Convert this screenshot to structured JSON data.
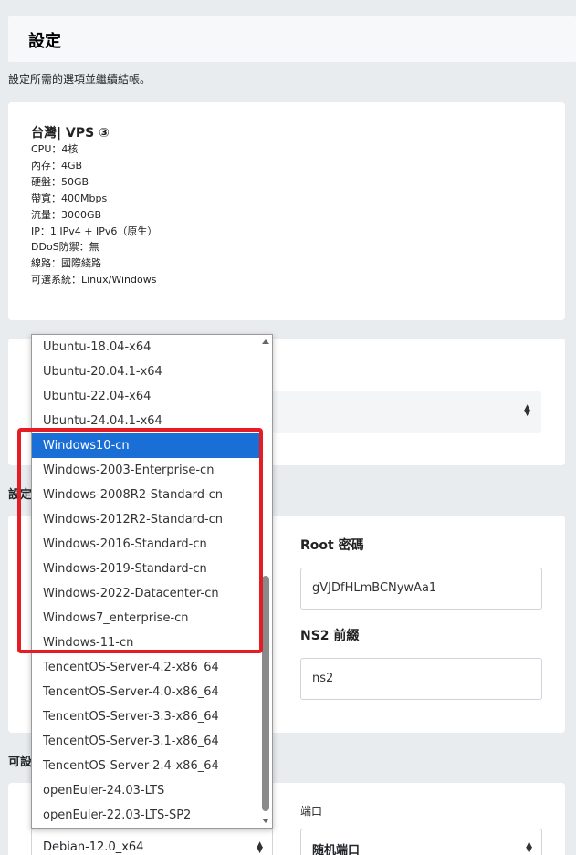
{
  "header": {
    "title": "設定"
  },
  "intro_text": "設定所需的選項並繼續結帳。",
  "product": {
    "name": "台灣| VPS ③",
    "specs": [
      "CPU：4核",
      "內存：4GB",
      "硬盤：50GB",
      "帶寬：400Mbps",
      "流量：3000GB",
      "IP：1 IPv4 + IPv6（原生）",
      "DDoS防禦：無",
      "線路：國際綫路",
      "可選系統：Linux/Windows"
    ]
  },
  "section_labels": {
    "config": "設定",
    "options": "可設"
  },
  "fields": {
    "root_password": {
      "label": "Root 密碼",
      "value": "gVJDfHLmBCNywAa1"
    },
    "ns2_prefix": {
      "label": "NS2 前綴",
      "value": "ns2"
    }
  },
  "bottom": {
    "port_label": "端口",
    "os_value": "Debian-12.0_x64",
    "port_value": "随机端口"
  },
  "dropdown": {
    "options": [
      "Ubuntu-18.04-x64",
      "Ubuntu-20.04.1-x64",
      "Ubuntu-22.04-x64",
      "Ubuntu-24.04.1-x64",
      "Windows10-cn",
      "Windows-2003-Enterprise-cn",
      "Windows-2008R2-Standard-cn",
      "Windows-2012R2-Standard-cn",
      "Windows-2016-Standard-cn",
      "Windows-2019-Standard-cn",
      "Windows-2022-Datacenter-cn",
      "Windows7_enterprise-cn",
      "Windows-11-cn",
      "TencentOS-Server-4.2-x86_64",
      "TencentOS-Server-4.0-x86_64",
      "TencentOS-Server-3.3-x86_64",
      "TencentOS-Server-3.1-x86_64",
      "TencentOS-Server-2.4-x86_64",
      "openEuler-24.03-LTS",
      "openEuler-22.03-LTS-SP2"
    ],
    "selected_index": 4
  },
  "colors": {
    "highlight_box": "#e51c23",
    "selected_option": "#1a6fd6",
    "page_background": "#e9ecef"
  }
}
